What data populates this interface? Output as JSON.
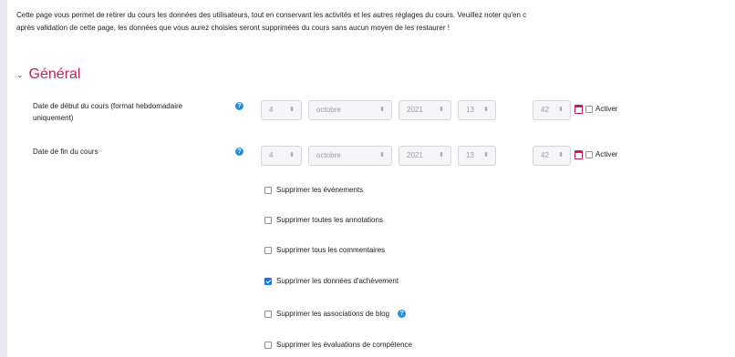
{
  "intro": {
    "line1": "Cette page vous permet de retirer du cours les données des utilisateurs, tout en conservant les activités et les autres réglages du cours. Veuillez noter qu'en c",
    "line2": "après validation de cette page, les données que vous aurez choisies seront supprimées du cours sans aucun moyen de les restaurer !"
  },
  "section": {
    "title": "Général",
    "chevron_icon": "chevron-down-icon"
  },
  "start_date": {
    "label": "Date de début du cours (format hebdomadaire uniquement)",
    "day": "4",
    "month": "octobre",
    "year": "2021",
    "hour": "13",
    "minute": "42",
    "enable_label": "Activer",
    "enabled": false
  },
  "end_date": {
    "label": "Date de fin du cours",
    "day": "4",
    "month": "octobre",
    "year": "2021",
    "hour": "13",
    "minute": "42",
    "enable_label": "Activer",
    "enabled": false
  },
  "options": [
    {
      "label": "Supprimer les événements",
      "checked": false,
      "help": false
    },
    {
      "label": "Supprimer toutes les annotations",
      "checked": false,
      "help": false
    },
    {
      "label": "Supprimer tous les commentaires",
      "checked": false,
      "help": false
    },
    {
      "label": "Supprimer les données d'achèvement",
      "checked": true,
      "help": false
    },
    {
      "label": "Supprimer les associations de blog",
      "checked": false,
      "help": true
    },
    {
      "label": "Supprimer les évaluations de compétence",
      "checked": false,
      "help": false
    }
  ],
  "colors": {
    "accent": "#c31c61",
    "help": "#2f8cd8",
    "checkbox_checked": "#1a73e8"
  },
  "icons": {
    "help": "question-circle-icon",
    "calendar": "calendar-icon",
    "select_arrow": "sort-arrows-icon"
  }
}
